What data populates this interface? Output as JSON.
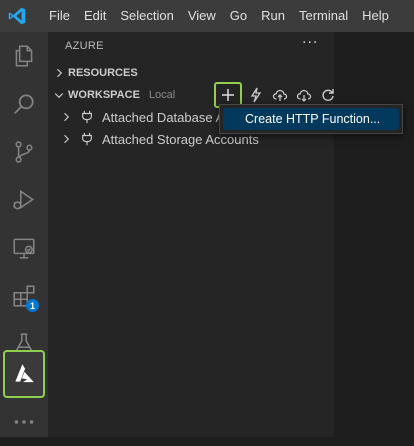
{
  "menubar": {
    "items": [
      "File",
      "Edit",
      "Selection",
      "View",
      "Go",
      "Run",
      "Terminal",
      "Help"
    ]
  },
  "activitybar": {
    "icons": [
      "explorer-icon",
      "search-icon",
      "source-control-icon",
      "run-debug-icon",
      "remote-explorer-icon",
      "extensions-icon",
      "testing-icon",
      "azure-icon",
      "more-icon"
    ],
    "extensions_badge": "1"
  },
  "sidebar": {
    "title": "AZURE",
    "more": "···",
    "resources_label": "RESOURCES",
    "workspace_label": "WORKSPACE",
    "workspace_desc": "Local",
    "tree": [
      {
        "label": "Attached Database Accounts"
      },
      {
        "label": "Attached Storage Accounts"
      }
    ]
  },
  "context_menu": {
    "item": "Create HTTP Function..."
  },
  "colors": {
    "highlight": "#8fd14f",
    "accent": "#0078d4",
    "menu_selected": "#04395e"
  }
}
